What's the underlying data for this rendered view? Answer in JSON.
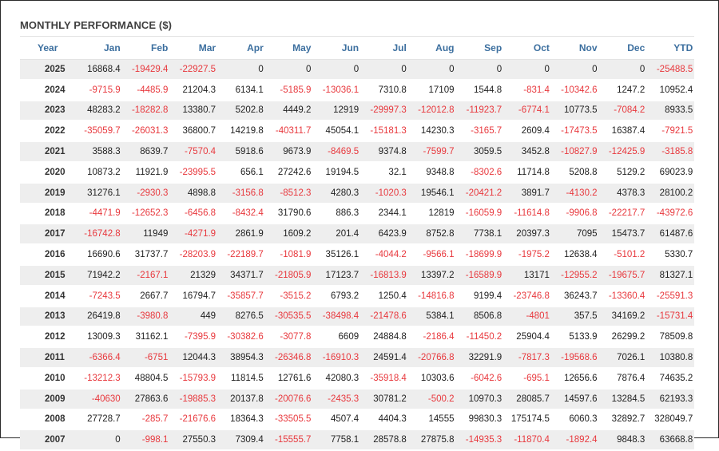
{
  "title": "MONTHLY PERFORMANCE ($)",
  "colors": {
    "negative": "#e8383d",
    "header": "#3c6f9f"
  },
  "headers": [
    "Year",
    "Jan",
    "Feb",
    "Mar",
    "Apr",
    "May",
    "Jun",
    "Jul",
    "Aug",
    "Sep",
    "Oct",
    "Nov",
    "Dec",
    "YTD"
  ],
  "rows": [
    [
      "2025",
      "16868.4",
      "-19429.4",
      "-22927.5",
      "0",
      "0",
      "0",
      "0",
      "0",
      "0",
      "0",
      "0",
      "0",
      "-25488.5"
    ],
    [
      "2024",
      "-9715.9",
      "-4485.9",
      "21204.3",
      "6134.1",
      "-5185.9",
      "-13036.1",
      "7310.8",
      "17109",
      "1544.8",
      "-831.4",
      "-10342.6",
      "1247.2",
      "10952.4"
    ],
    [
      "2023",
      "48283.2",
      "-18282.8",
      "13380.7",
      "5202.8",
      "4449.2",
      "12919",
      "-29997.3",
      "-12012.8",
      "-11923.7",
      "-6774.1",
      "10773.5",
      "-7084.2",
      "8933.5"
    ],
    [
      "2022",
      "-35059.7",
      "-26031.3",
      "36800.7",
      "14219.8",
      "-40311.7",
      "45054.1",
      "-15181.3",
      "14230.3",
      "-3165.7",
      "2609.4",
      "-17473.5",
      "16387.4",
      "-7921.5"
    ],
    [
      "2021",
      "3588.3",
      "8639.7",
      "-7570.4",
      "5918.6",
      "9673.9",
      "-8469.5",
      "9374.8",
      "-7599.7",
      "3059.5",
      "3452.8",
      "-10827.9",
      "-12425.9",
      "-3185.8"
    ],
    [
      "2020",
      "10873.2",
      "11921.9",
      "-23995.5",
      "656.1",
      "27242.6",
      "19194.5",
      "32.1",
      "9348.8",
      "-8302.6",
      "11714.8",
      "5208.8",
      "5129.2",
      "69023.9"
    ],
    [
      "2019",
      "31276.1",
      "-2930.3",
      "4898.8",
      "-3156.8",
      "-8512.3",
      "4280.3",
      "-1020.3",
      "19546.1",
      "-20421.2",
      "3891.7",
      "-4130.2",
      "4378.3",
      "28100.2"
    ],
    [
      "2018",
      "-4471.9",
      "-12652.3",
      "-6456.8",
      "-8432.4",
      "31790.6",
      "886.3",
      "2344.1",
      "12819",
      "-16059.9",
      "-11614.8",
      "-9906.8",
      "-22217.7",
      "-43972.6"
    ],
    [
      "2017",
      "-16742.8",
      "11949",
      "-4271.9",
      "2861.9",
      "1609.2",
      "201.4",
      "6423.9",
      "8752.8",
      "7738.1",
      "20397.3",
      "7095",
      "15473.7",
      "61487.6"
    ],
    [
      "2016",
      "16690.6",
      "31737.7",
      "-28203.9",
      "-22189.7",
      "-1081.9",
      "35126.1",
      "-4044.2",
      "-9566.1",
      "-18699.9",
      "-1975.2",
      "12638.4",
      "-5101.2",
      "5330.7"
    ],
    [
      "2015",
      "71942.2",
      "-2167.1",
      "21329",
      "34371.7",
      "-21805.9",
      "17123.7",
      "-16813.9",
      "13397.2",
      "-16589.9",
      "13171",
      "-12955.2",
      "-19675.7",
      "81327.1"
    ],
    [
      "2014",
      "-7243.5",
      "2667.7",
      "16794.7",
      "-35857.7",
      "-3515.2",
      "6793.2",
      "1250.4",
      "-14816.8",
      "9199.4",
      "-23746.8",
      "36243.7",
      "-13360.4",
      "-25591.3"
    ],
    [
      "2013",
      "26419.8",
      "-3980.8",
      "449",
      "8276.5",
      "-30535.5",
      "-38498.4",
      "-21478.6",
      "5384.1",
      "8506.8",
      "-4801",
      "357.5",
      "34169.2",
      "-15731.4"
    ],
    [
      "2012",
      "13009.3",
      "31162.1",
      "-7395.9",
      "-30382.6",
      "-3077.8",
      "6609",
      "24884.8",
      "-2186.4",
      "-11450.2",
      "25904.4",
      "5133.9",
      "26299.2",
      "78509.8"
    ],
    [
      "2011",
      "-6366.4",
      "-6751",
      "12044.3",
      "38954.3",
      "-26346.8",
      "-16910.3",
      "24591.4",
      "-20766.8",
      "32291.9",
      "-7817.3",
      "-19568.6",
      "7026.1",
      "10380.8"
    ],
    [
      "2010",
      "-13212.3",
      "48804.5",
      "-15793.9",
      "11814.5",
      "12761.6",
      "42080.3",
      "-35918.4",
      "10303.6",
      "-6042.6",
      "-695.1",
      "12656.6",
      "7876.4",
      "74635.2"
    ],
    [
      "2009",
      "-40630",
      "27863.6",
      "-19885.3",
      "20137.8",
      "-20076.6",
      "-2435.3",
      "30781.2",
      "-500.2",
      "10970.3",
      "28085.7",
      "14597.6",
      "13284.5",
      "62193.3"
    ],
    [
      "2008",
      "27728.7",
      "-285.7",
      "-21676.6",
      "18364.3",
      "-33505.5",
      "4507.4",
      "4404.3",
      "14555",
      "99830.3",
      "175174.5",
      "6060.3",
      "32892.7",
      "328049.7"
    ],
    [
      "2007",
      "0",
      "-998.1",
      "27550.3",
      "7309.4",
      "-15555.7",
      "7758.1",
      "28578.8",
      "27875.8",
      "-14935.3",
      "-11870.4",
      "-1892.4",
      "9848.3",
      "63668.8"
    ]
  ]
}
